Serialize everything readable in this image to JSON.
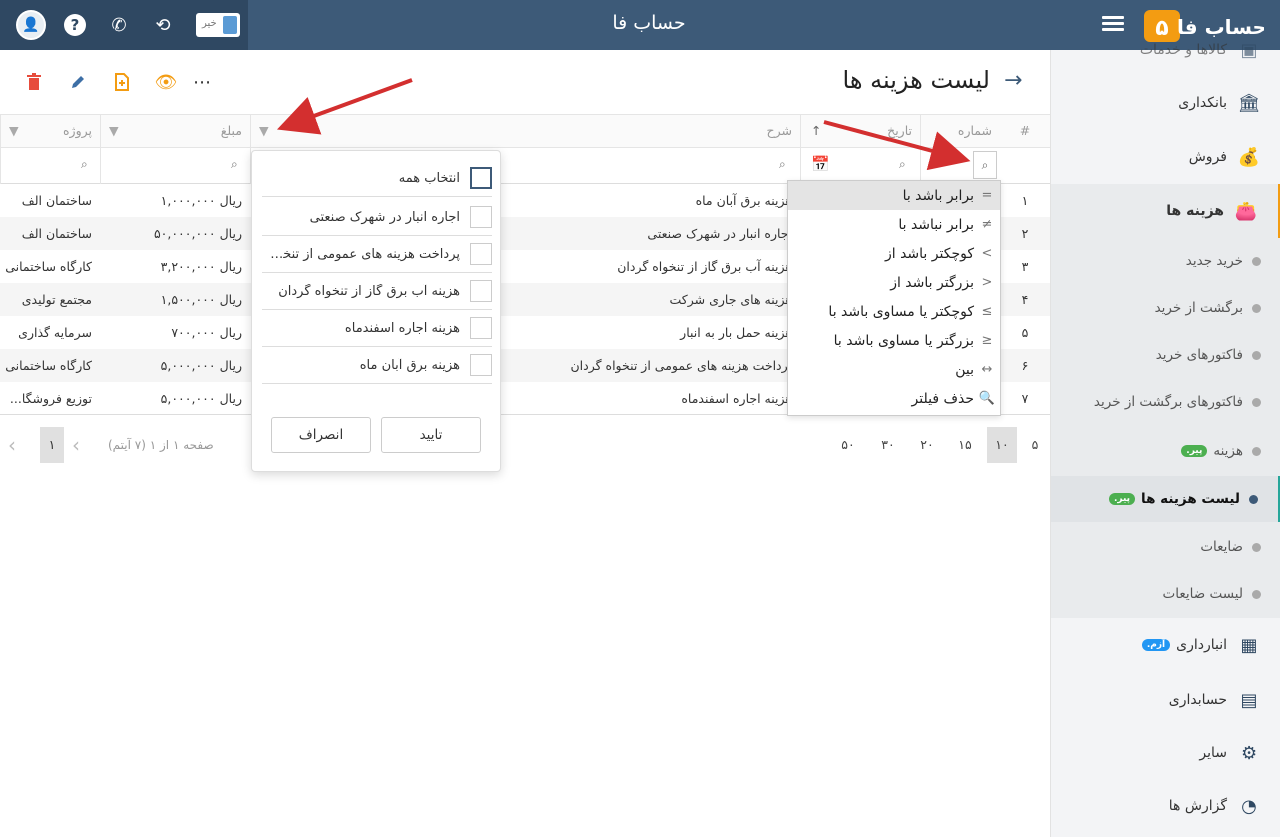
{
  "topbar": {
    "app_title": "حساب فا",
    "toggle_label": "خیر",
    "logo_text": "حساب فا"
  },
  "sidebar": {
    "items": [
      {
        "label": "کالاها و خدمات"
      },
      {
        "label": "بانکداری"
      },
      {
        "label": "فروش"
      },
      {
        "label": "هزینه ها"
      },
      {
        "label": "انبارداری",
        "badge": "آزم."
      },
      {
        "label": "حسابداری"
      },
      {
        "label": "سایر"
      },
      {
        "label": "گزارش ها"
      }
    ],
    "sub_items": [
      {
        "label": "خرید جدید"
      },
      {
        "label": "برگشت از خرید"
      },
      {
        "label": "فاکتورهای خرید"
      },
      {
        "label": "فاکتورهای برگشت از خرید"
      },
      {
        "label": "هزینه",
        "badge": "پیر."
      },
      {
        "label": "لیست هزینه ها",
        "badge": "پیر."
      },
      {
        "label": "ضایعات"
      },
      {
        "label": "لیست ضایعات"
      }
    ]
  },
  "page": {
    "title": "لیست هزینه ها"
  },
  "grid": {
    "columns": [
      "#",
      "شماره",
      "تاریخ",
      "شرح",
      "مبلغ",
      "پروژه"
    ],
    "rows": [
      {
        "idx": "۱",
        "description": "هزینه برق آبان ماه",
        "amount": "ریال ۱,۰۰۰,۰۰۰",
        "project": "ساختمان الف"
      },
      {
        "idx": "۲",
        "description": "اجاره انبار در شهرک صنعتی",
        "amount": "ریال ۵۰,۰۰۰,۰۰۰",
        "project": "ساختمان الف"
      },
      {
        "idx": "۳",
        "description": "هزینه آب برق گاز از تنخواه گردان",
        "amount": "ریال ۳,۲۰۰,۰۰۰",
        "project": "کارگاه ساختمانی"
      },
      {
        "idx": "۴",
        "description": "هزینه های جاری شرکت",
        "amount": "ریال ۱,۵۰۰,۰۰۰",
        "project": "مجتمع تولیدی"
      },
      {
        "idx": "۵",
        "description": "هزینه حمل بار به انبار",
        "amount": "ریال ۷۰۰,۰۰۰",
        "project": "سرمایه گذاری"
      },
      {
        "idx": "۶",
        "description": "پرداخت هزینه های عمومی از تنخواه گردان",
        "amount": "ریال ۵,۰۰۰,۰۰۰",
        "project": "کارگاه ساختمانی"
      },
      {
        "idx": "۷",
        "description": "هزینه اجاره اسفندماه",
        "amount": "ریال ۵,۰۰۰,۰۰۰",
        "project": "توزیع فروشگا..."
      }
    ]
  },
  "pager": {
    "page_sizes": [
      "۵",
      "۱۰",
      "۱۵",
      "۲۰",
      "۳۰",
      "۵۰"
    ],
    "info": "صفحه ۱ از ۱ (۷ آیتم)",
    "current_page": "۱"
  },
  "operator_menu": [
    {
      "symbol": "=",
      "label": "برابر باشد با"
    },
    {
      "symbol": "≠",
      "label": "برابر نباشد با"
    },
    {
      "symbol": ">",
      "label": "کوچکتر باشد از"
    },
    {
      "symbol": "<",
      "label": "بزرگتر باشد از"
    },
    {
      "symbol": "≥",
      "label": "کوچکتر یا مساوی باشد با"
    },
    {
      "symbol": "≤",
      "label": "بزرگتر یا مساوی باشد با"
    },
    {
      "symbol": "↔",
      "label": "بین"
    },
    {
      "symbol": "🔍",
      "label": "حذف فیلتر"
    }
  ],
  "value_filter": {
    "select_all": "انتخاب همه",
    "options": [
      "اجاره انبار در شهرک صنعتی",
      "پرداخت هزینه های عمومی از تنخواه گردان",
      "هزینه آب برق گاز از تنخواه گردان",
      "هزینه اجاره اسفندماه",
      "هزینه برق آبان ماه"
    ],
    "confirm_label": "تایید",
    "cancel_label": "انصراف"
  },
  "colors": {
    "topbar": "#3d5a78",
    "accent_orange": "#f39c12",
    "danger": "#e74c3c",
    "arrow": "#d32f2f"
  }
}
